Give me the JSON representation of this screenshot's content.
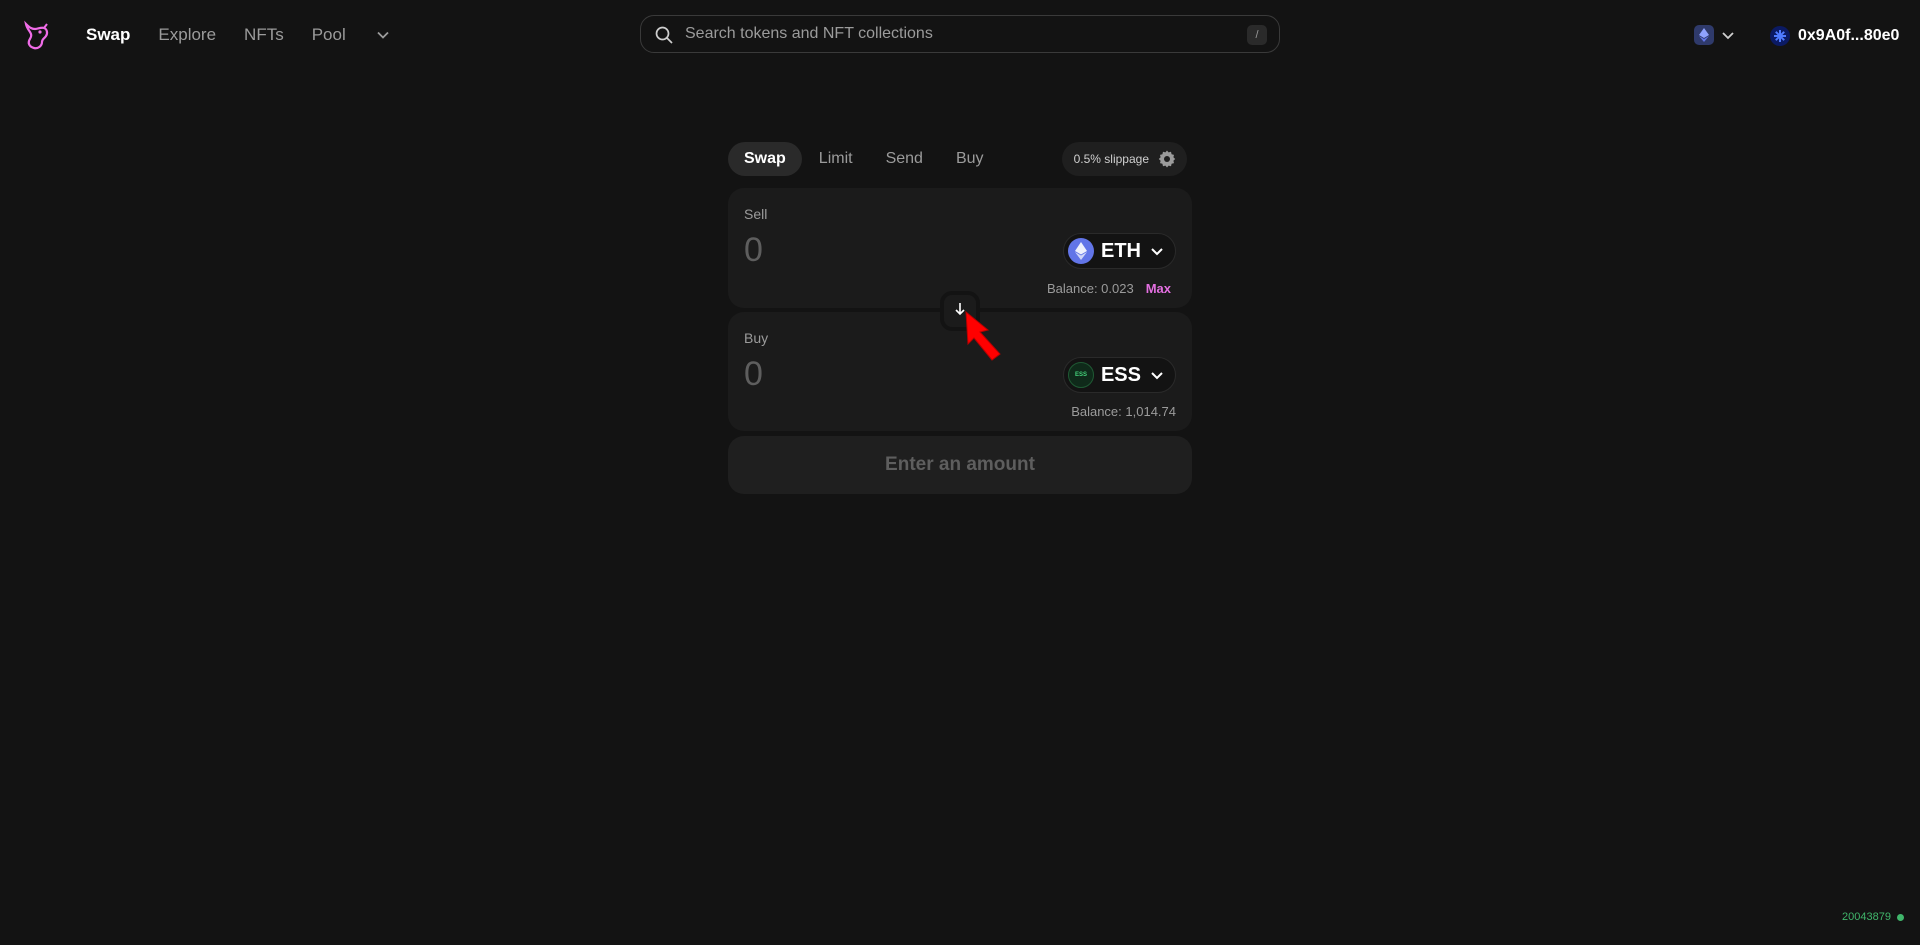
{
  "nav": {
    "items": [
      {
        "label": "Swap",
        "active": true
      },
      {
        "label": "Explore",
        "active": false
      },
      {
        "label": "NFTs",
        "active": false
      },
      {
        "label": "Pool",
        "active": false
      }
    ]
  },
  "search": {
    "placeholder": "Search tokens and NFT collections",
    "shortcut": "/"
  },
  "account": {
    "address": "0x9A0f...80e0"
  },
  "swap_tabs": [
    "Swap",
    "Limit",
    "Send",
    "Buy"
  ],
  "slippage": "0.5% slippage",
  "sell": {
    "label": "Sell",
    "amount_placeholder": "0",
    "token": "ETH",
    "balance": "Balance: 0.023",
    "max": "Max"
  },
  "buy": {
    "label": "Buy",
    "amount_placeholder": "0",
    "token": "ESS",
    "token_logo_text": "ESS",
    "balance": "Balance: 1,014.74"
  },
  "action": {
    "label": "Enter an amount"
  },
  "footer": {
    "block_number": "20043879"
  },
  "colors": {
    "background": "#131313",
    "panel": "#1b1b1b",
    "accent_pink": "#e36fe0",
    "eth_blue": "#6275e8",
    "block_green": "#40b66b",
    "cursor_red": "#ff0000"
  },
  "icons": [
    "uniswap-logo",
    "chevron-down-icon",
    "search-icon",
    "ethereum-icon",
    "avatar-icon",
    "gear-icon",
    "arrow-down-icon",
    "cursor-arrow"
  ]
}
